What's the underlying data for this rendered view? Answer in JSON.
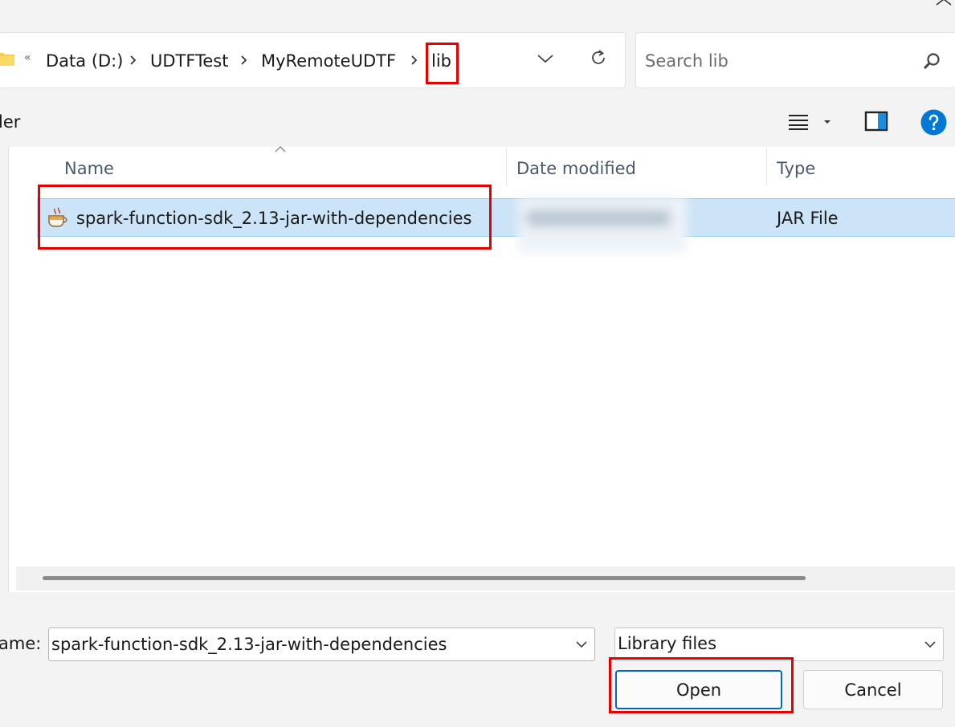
{
  "address_bar": {
    "overflow_glyph": "«",
    "breadcrumbs": [
      "Data (D:)",
      "UDTFTest",
      "MyRemoteUDTF",
      "lib"
    ]
  },
  "search": {
    "placeholder": "Search lib"
  },
  "toolbar": {
    "left_label": "ler"
  },
  "columns": {
    "name": "Name",
    "date_modified": "Date modified",
    "type": "Type"
  },
  "files": [
    {
      "name": "spark-function-sdk_2.13-jar-with-dependencies",
      "type": "JAR File",
      "date_modified": "(blurred)"
    }
  ],
  "file_name": {
    "label": "ame:",
    "value": "spark-function-sdk_2.13-jar-with-dependencies"
  },
  "file_type_filter": {
    "selected": "Library files"
  },
  "buttons": {
    "open": "Open",
    "cancel": "Cancel"
  },
  "colors": {
    "accent": "#0067c0",
    "selection": "#cce4f7",
    "highlight": "#e60000",
    "help": "#0078d4"
  }
}
